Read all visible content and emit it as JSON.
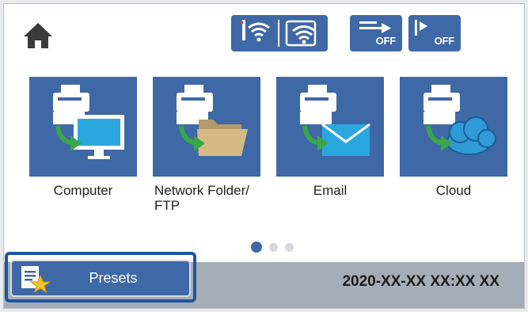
{
  "status_bar": {
    "home_icon": "home-icon",
    "network_icons": [
      "wifi-direct-icon",
      "wifi-icon"
    ],
    "toggle_icons": [
      {
        "icon": "forward-icon",
        "state": "OFF"
      },
      {
        "icon": "print-speed-icon",
        "state": "OFF"
      }
    ]
  },
  "destinations": [
    {
      "label": "Computer",
      "icon": "computer-icon"
    },
    {
      "label": "Network Folder/\nFTP",
      "icon": "folder-icon"
    },
    {
      "label": "Email",
      "icon": "email-icon"
    },
    {
      "label": "Cloud",
      "icon": "cloud-icon"
    }
  ],
  "pager": {
    "current": 1,
    "total": 3
  },
  "bottom_bar": {
    "presets_label": "Presets",
    "datetime": "2020-XX-XX XX:XX XX"
  },
  "colors": {
    "tile": "#3f68a7",
    "highlight_frame": "#1d56a0",
    "bottom_bar": "#a5adb6",
    "arrow_green": "#3aa64a",
    "screen_cyan": "#2aa7df",
    "folder_tan": "#d4b986",
    "cloud_blue": "#2f9ad6",
    "star_gold": "#f2c12e"
  }
}
